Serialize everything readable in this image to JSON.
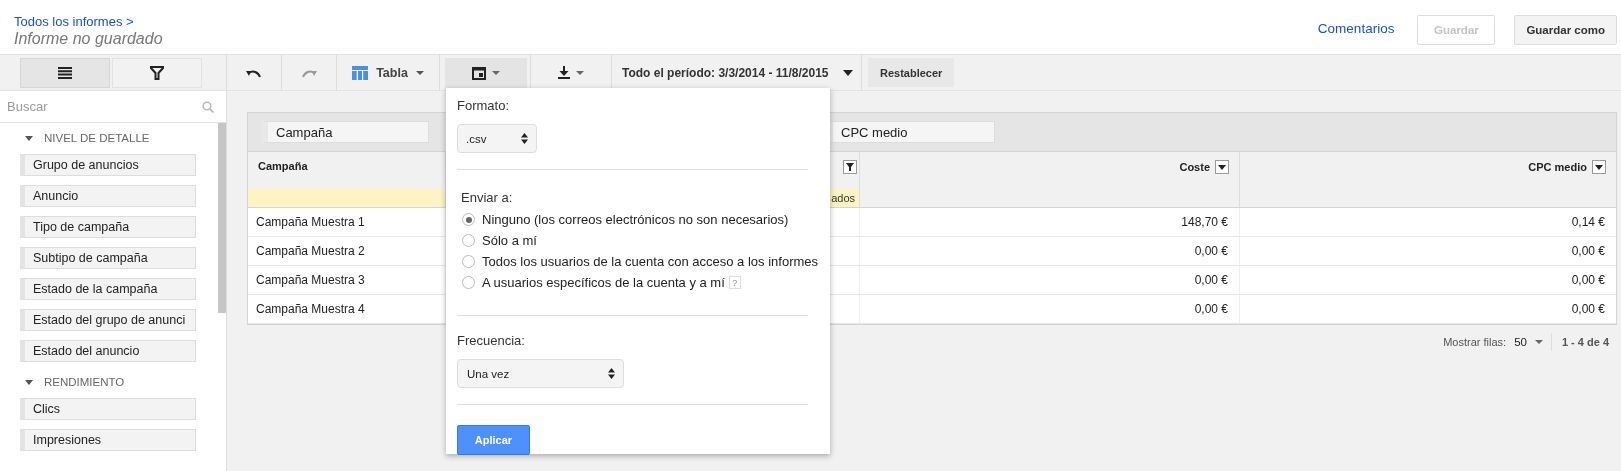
{
  "header": {
    "breadcrumb": "Todos los informes >",
    "title": "Informe no guardado",
    "comments_link": "Comentarios",
    "buttons": [
      {
        "label": "Guardar",
        "disabled": true
      },
      {
        "label": "Guardar como",
        "disabled": false
      }
    ]
  },
  "sidebar_tabs": [
    {
      "kind": "list",
      "selected": true
    },
    {
      "kind": "filter",
      "selected": false
    }
  ],
  "toolbar": [
    {
      "kind": "undo",
      "disabled": false
    },
    {
      "kind": "redo",
      "disabled": true
    },
    {
      "kind": "table",
      "label": "Tabla"
    },
    {
      "kind": "export",
      "open": true
    },
    {
      "kind": "download"
    },
    {
      "kind": "date",
      "label": "Todo el período: 3/3/2014 - 11/8/2015"
    },
    {
      "kind": "reset",
      "label": "Restablecer"
    }
  ],
  "sidebar": {
    "search": {
      "placeholder": "Buscar"
    },
    "sections": [
      {
        "title": "NIVEL DE DETALLE",
        "expanded": true,
        "items": [
          "Grupo de anuncios",
          "Anuncio",
          "Tipo de campaña",
          "Subtipo de campaña",
          "Estado de la campaña",
          "Estado del grupo de anunci",
          "Estado del anuncio"
        ]
      },
      {
        "title": "RENDIMIENTO",
        "expanded": true,
        "items": [
          "Clics",
          "Impresiones"
        ]
      }
    ]
  },
  "table": {
    "chips": [
      "Campaña",
      "CPC medio"
    ],
    "columns": [
      {
        "kind": "text",
        "label": "Campaña"
      },
      {
        "kind": "covered",
        "note": "ados"
      },
      {
        "kind": "number",
        "label": "Coste"
      },
      {
        "kind": "number",
        "label": "CPC medio"
      }
    ],
    "rows": [
      {
        "campaign": "Campaña Muestra 1",
        "cost": "148,70 €",
        "cpc": "0,14 €"
      },
      {
        "campaign": "Campaña Muestra 2",
        "cost": "0,00 €",
        "cpc": "0,00 €"
      },
      {
        "campaign": "Campaña Muestra 3",
        "cost": "0,00 €",
        "cpc": "0,00 €"
      },
      {
        "campaign": "Campaña Muestra 4",
        "cost": "0,00 €",
        "cpc": "0,00 €"
      }
    ]
  },
  "pagination": {
    "label": "Mostrar filas:",
    "rows": "50",
    "range": "1 - 4 de 4"
  },
  "export_popup": {
    "format_label": "Formato:",
    "format": ".csv",
    "send_label": "Enviar a:",
    "recipients": [
      {
        "label": "Ninguno (los correos electrónicos no son necesarios)",
        "selected": true,
        "help": false
      },
      {
        "label": "Sólo a mí",
        "selected": false,
        "help": false
      },
      {
        "label": "Todos los usuarios de la cuenta con acceso a los informes",
        "selected": false,
        "help": false
      },
      {
        "label": "A usuarios específicos de la cuenta y a mí",
        "selected": false,
        "help": true
      }
    ],
    "help_mark": "?",
    "frequency_label": "Frecuencia:",
    "frequency": "Una vez",
    "apply": "Aplicar"
  }
}
